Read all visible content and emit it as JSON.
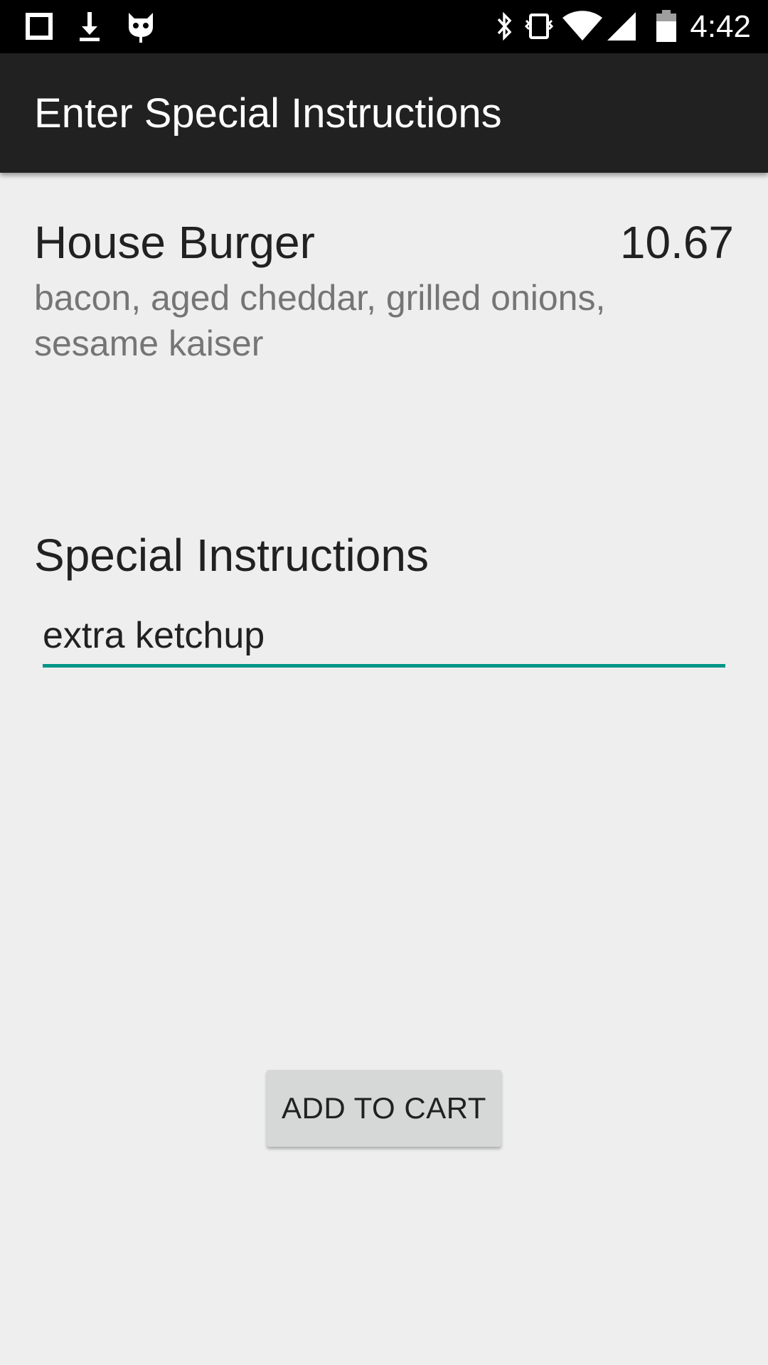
{
  "status_bar": {
    "left_icons": [
      "square-notification-icon",
      "download-icon",
      "cyanogen-bug-icon"
    ],
    "right_icons": [
      "bluetooth-icon",
      "vibrate-icon",
      "wifi-icon",
      "cell-signal-icon",
      "battery-icon"
    ],
    "time": "4:42"
  },
  "app_bar": {
    "title": "Enter Special Instructions",
    "background": "#212121"
  },
  "item": {
    "name": "House Burger",
    "price": "10.67",
    "description": "bacon, aged cheddar, grilled onions, sesame kaiser"
  },
  "instructions": {
    "label": "Special Instructions",
    "value": "extra ketchup",
    "accent_color": "#009688"
  },
  "actions": {
    "add_to_cart_label": "ADD TO CART"
  }
}
